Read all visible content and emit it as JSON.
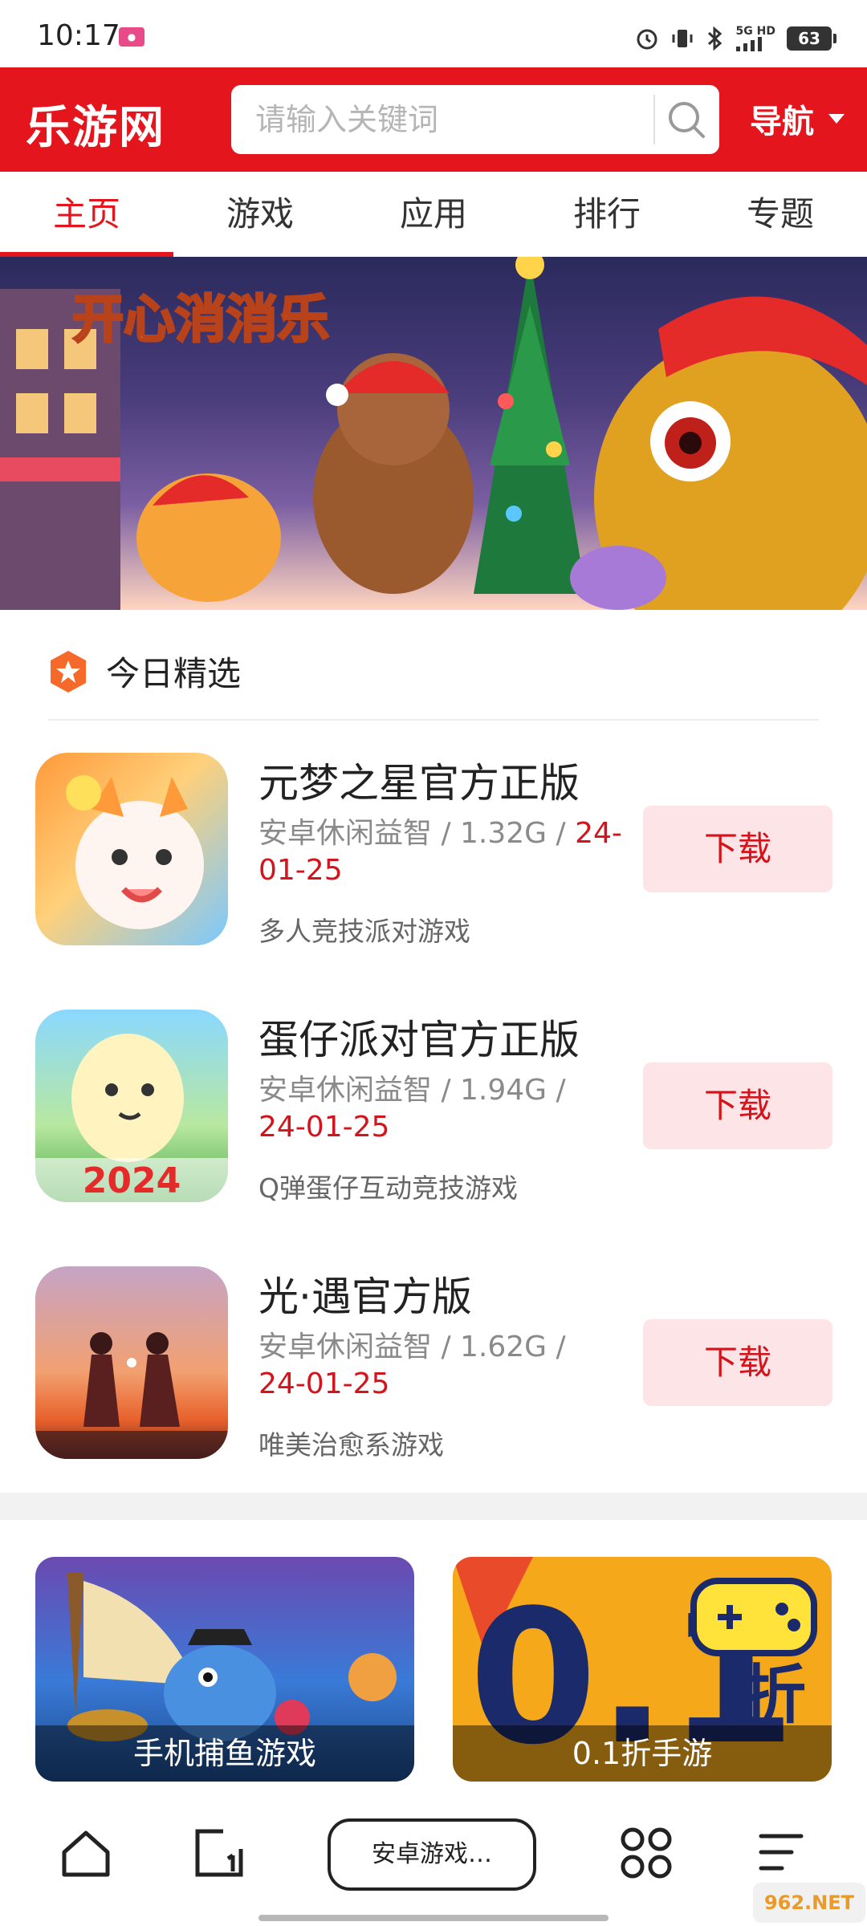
{
  "status_bar": {
    "time": "10:17",
    "network": "5G HD",
    "battery": "63"
  },
  "header": {
    "logo": "乐游网",
    "search_placeholder": "请输入关键词",
    "nav_label": "导航"
  },
  "tabs": [
    {
      "label": "主页",
      "active": true
    },
    {
      "label": "游戏",
      "active": false
    },
    {
      "label": "应用",
      "active": false
    },
    {
      "label": "排行",
      "active": false
    },
    {
      "label": "专题",
      "active": false
    }
  ],
  "banner": {
    "title_art": "开心消消乐"
  },
  "section": {
    "title": "今日精选"
  },
  "apps": [
    {
      "name": "元梦之星官方正版",
      "meta_prefix": "安卓休闲益智 / 1.32G / ",
      "date": "24-01-25",
      "desc": "多人竞技派对游戏",
      "button": "下载"
    },
    {
      "name": "蛋仔派对官方正版",
      "meta_prefix": "安卓休闲益智 / 1.94G / ",
      "date": "24-01-25",
      "desc": "Q弹蛋仔互动竞技游戏",
      "button": "下载",
      "icon_text": "2024"
    },
    {
      "name": "光·遇官方版",
      "meta_prefix": "安卓休闲益智 / 1.62G / ",
      "date": "24-01-25",
      "desc": "唯美治愈系游戏",
      "button": "下载"
    }
  ],
  "promos": [
    {
      "label": "手机捕鱼游戏"
    },
    {
      "label": "0.1折手游",
      "art_text": "0.1",
      "art_sub": "折"
    }
  ],
  "bottom_bar": {
    "address": "安卓游戏…",
    "watermark": "962.NET"
  },
  "colors": {
    "brand": "#e5151d",
    "download_bg": "#fde5e7",
    "date_red": "#d4141c"
  }
}
